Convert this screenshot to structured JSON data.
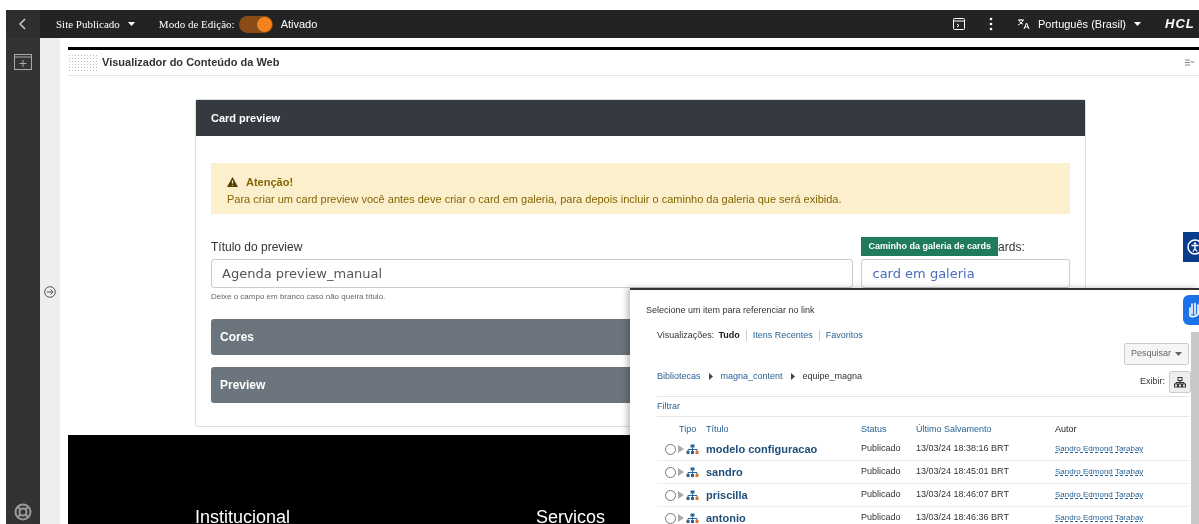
{
  "topbar": {
    "publish_menu": "Site Publicado",
    "edit_mode_label": "Modo de Edição:",
    "edit_mode": {
      "on": true,
      "label": "Ativado"
    },
    "language": "Português (Brasil)",
    "logo": "HCL"
  },
  "portlet": {
    "title": "Visualizador do Conteúdo da Web"
  },
  "card": {
    "title": "Card preview",
    "alert": {
      "title": "Atenção!",
      "text": "Para criar um card preview você antes deve criar o card em galeria, para depois incluir o caminho da galeria que será exibida."
    },
    "fields": [
      {
        "label": "Título do preview",
        "value": "Agenda preview_manual",
        "help": "Deixe o campo em branco caso não queira título."
      },
      {
        "label": "ards:",
        "tooltip": "Caminho da galeria de cards",
        "value": "card em galeria"
      }
    ],
    "sections": [
      {
        "title": "Cores"
      },
      {
        "title": "Preview"
      }
    ]
  },
  "footer": {
    "headings": [
      "Institucional",
      "Servicos"
    ]
  },
  "dialog": {
    "prompt": "Selecione um item para referenciar no link",
    "views_label": "Visualizações:",
    "views": [
      {
        "label": "Tudo",
        "selected": true
      },
      {
        "label": "Itens Recentes",
        "selected": false
      },
      {
        "label": "Favoritos",
        "selected": false
      }
    ],
    "search_button": "Pesquisar",
    "breadcrumb": [
      "Bibliotecas",
      "magna_content",
      "equipe_magna"
    ],
    "display_label": "Exibir:",
    "filter_link": "Filtrar",
    "columns": [
      "Tipo",
      "Título",
      "Status",
      "Último Salvamento",
      "Autor"
    ],
    "rows": [
      {
        "checked": false,
        "title": "modelo configuracao",
        "status": "Publicado",
        "saved": "13/03/24 18:38:16 BRT",
        "author": "Sandro Edmond Tarabay"
      },
      {
        "checked": false,
        "title": "sandro",
        "status": "Publicado",
        "saved": "13/03/24 18:45:01 BRT",
        "author": "Sandro Edmond Tarabay"
      },
      {
        "checked": false,
        "title": "priscilla",
        "status": "Publicado",
        "saved": "13/03/24 18:46:07 BRT",
        "author": "Sandro Edmond Tarabay"
      },
      {
        "checked": false,
        "title": "antonio",
        "status": "Publicado",
        "saved": "13/03/24 18:46:36 BRT",
        "author": "Sandro Edmond Tarabay"
      }
    ]
  }
}
